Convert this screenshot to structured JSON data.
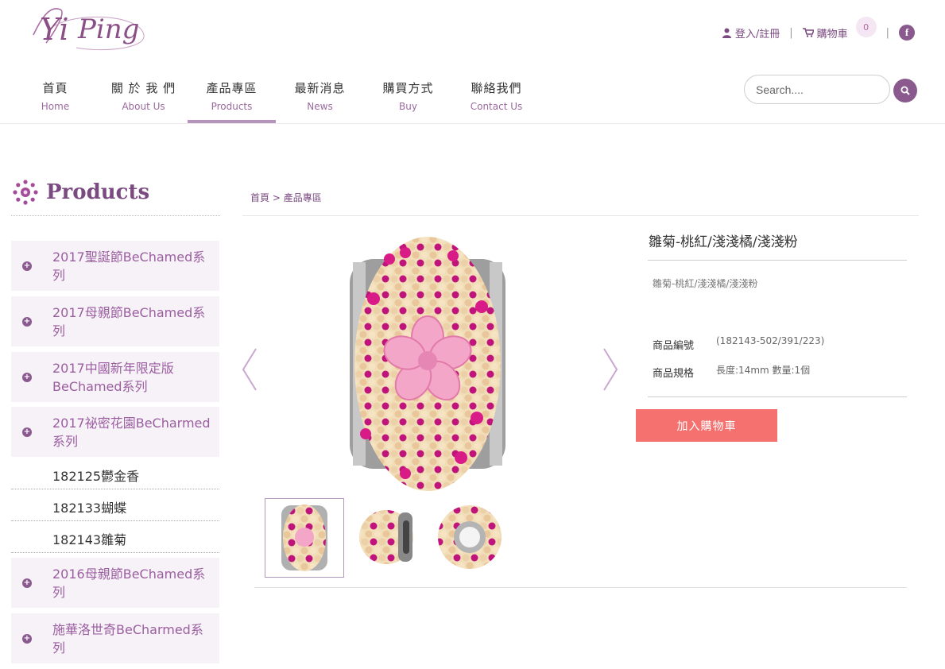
{
  "header": {
    "logo_text": "YiPing",
    "login_label": "登入/註冊",
    "cart_label": "購物車",
    "cart_count": "0",
    "facebook_label": "f"
  },
  "nav": {
    "items": [
      {
        "zh": "首頁",
        "en": "Home"
      },
      {
        "zh": "關 於 我 們",
        "en": "About Us"
      },
      {
        "zh": "產品專區",
        "en": "Products"
      },
      {
        "zh": "最新消息",
        "en": "News"
      },
      {
        "zh": "購買方式",
        "en": "Buy"
      },
      {
        "zh": "聯絡我們",
        "en": "Contact Us"
      }
    ],
    "active_index": 2
  },
  "search": {
    "placeholder": "Search...."
  },
  "sidebar": {
    "title": "Products",
    "categories": [
      {
        "label": "2017聖誕節BeChamed系列"
      },
      {
        "label": "2017母親節BeChamed系列"
      },
      {
        "label": "2017中國新年限定版BeChamed系列"
      },
      {
        "label": "2017祕密花園BeCharmed系列"
      },
      {
        "label": "2016母親節BeChamed系列"
      },
      {
        "label": "施華洛世奇BeCharmed系列"
      }
    ],
    "subitems": [
      {
        "label": "182125鬱金香"
      },
      {
        "label": "182133蝴蝶"
      },
      {
        "label": "182143雛菊"
      }
    ]
  },
  "breadcrumb": {
    "home": "首頁",
    "sep": ">",
    "current": "產品專區"
  },
  "product": {
    "title": "雛菊-桃紅/淺淺橘/淺淺粉",
    "description": "雛菊-桃紅/淺淺橘/淺淺粉",
    "spec_code_label": "商品編號",
    "spec_code_value": "(182143-502/391/223)",
    "spec_size_label": "商品規格",
    "spec_size_value": "長度:14mm 數量:1個",
    "add_to_cart": "加入購物車"
  },
  "colors": {
    "brand_purple": "#8a5a8f",
    "link_purple": "#9b5ea0",
    "add_cart_coral": "#f4716f",
    "sidebar_bg": "#f6f2f7"
  }
}
